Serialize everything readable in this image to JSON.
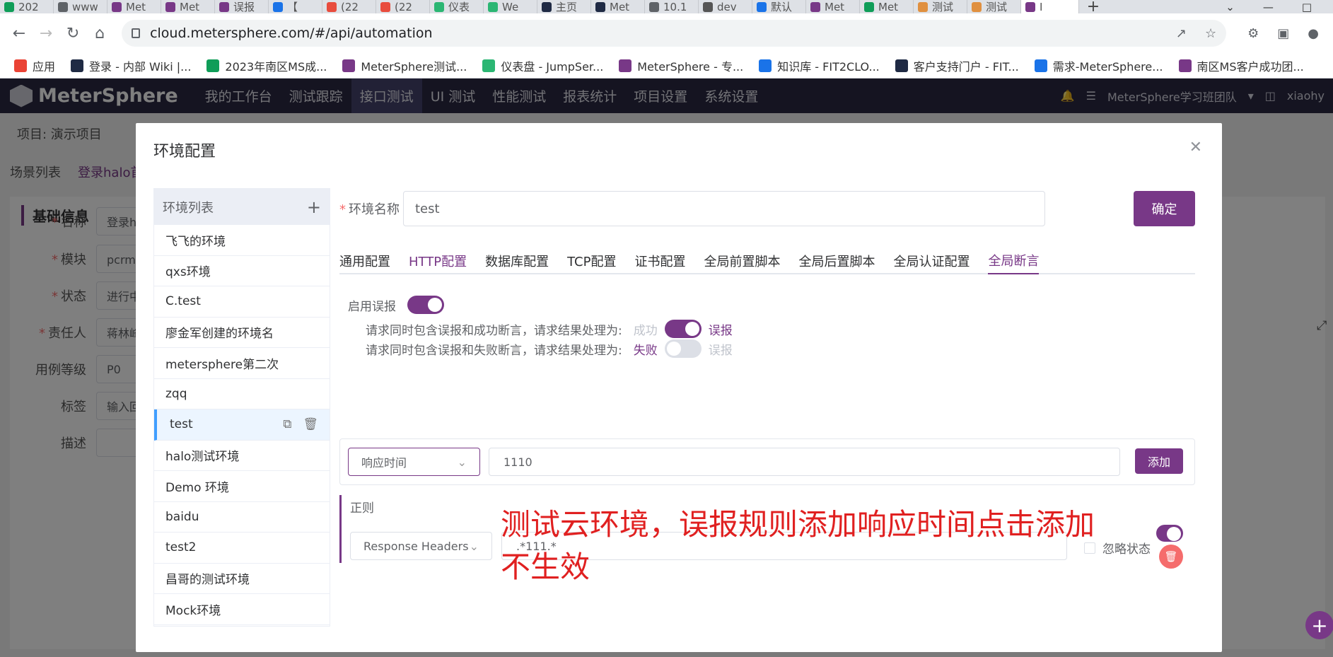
{
  "browser": {
    "tabs": [
      {
        "label": "202",
        "color": "#0f9d58"
      },
      {
        "label": "www",
        "color": "#5f6368"
      },
      {
        "label": "Met",
        "color": "#783887"
      },
      {
        "label": "Met",
        "color": "#783887"
      },
      {
        "label": "误报",
        "color": "#783887"
      },
      {
        "label": "【",
        "color": "#1a73e8"
      },
      {
        "label": "(22",
        "color": "#e84c3d"
      },
      {
        "label": "(22",
        "color": "#e84c3d"
      },
      {
        "label": "仪表",
        "color": "#2bb673"
      },
      {
        "label": "We",
        "color": "#2bb673"
      },
      {
        "label": "主页",
        "color": "#1f2a44"
      },
      {
        "label": "Met",
        "color": "#1f2a44"
      },
      {
        "label": "10.1",
        "color": "#5f6368"
      },
      {
        "label": "dev",
        "color": "#555555"
      },
      {
        "label": "默认",
        "color": "#1a73e8"
      },
      {
        "label": "Met",
        "color": "#783887"
      },
      {
        "label": "Met",
        "color": "#0f9d58"
      },
      {
        "label": "测试",
        "color": "#e09040"
      },
      {
        "label": "测试",
        "color": "#e09040"
      },
      {
        "label": "I",
        "color": "#783887"
      }
    ],
    "new_tab": "+",
    "url": "cloud.metersphere.com/#/api/automation",
    "bookmarks": [
      {
        "label": "应用",
        "color": "#ea4335"
      },
      {
        "label": "登录 - 内部 Wiki |...",
        "color": "#1f2a44"
      },
      {
        "label": "2023年南区MS成...",
        "color": "#0f9d58"
      },
      {
        "label": "MeterSphere测试...",
        "color": "#783887"
      },
      {
        "label": "仪表盘 - JumpSer...",
        "color": "#2bb673"
      },
      {
        "label": "MeterSphere - 专...",
        "color": "#783887"
      },
      {
        "label": "知识库 - FIT2CLO...",
        "color": "#1a73e8"
      },
      {
        "label": "客户支持门户 - FIT...",
        "color": "#1f2a44"
      },
      {
        "label": "需求-MeterSphere...",
        "color": "#1a73e8"
      },
      {
        "label": "南区MS客户成功团...",
        "color": "#783887"
      }
    ]
  },
  "app": {
    "logo": "MeterSphere",
    "menu": [
      "我的工作台",
      "测试跟踪",
      "接口测试",
      "UI 测试",
      "性能测试",
      "报表统计",
      "项目设置",
      "系统设置"
    ],
    "active_menu": 2,
    "team": "MeterSphere学习班团队",
    "user": "xiaohy"
  },
  "background": {
    "project": "项目: 演示项目",
    "tabs": [
      "场景列表",
      "登录halo首"
    ],
    "section": "基础信息",
    "fields": [
      {
        "label": "名称",
        "required": true,
        "value": "登录ha"
      },
      {
        "label": "模块",
        "required": true,
        "value": "pcrm个"
      },
      {
        "label": "状态",
        "required": true,
        "value": "进行中"
      },
      {
        "label": "责任人",
        "required": true,
        "value": "蒋林峰"
      },
      {
        "label": "用例等级",
        "required": false,
        "value": "P0"
      },
      {
        "label": "标签",
        "required": false,
        "value": "输入回车"
      },
      {
        "label": "描述",
        "required": false,
        "value": ""
      }
    ]
  },
  "dialog": {
    "title": "环境配置",
    "env_list_title": "环境列表",
    "environments": [
      "飞飞的环境",
      "qxs环境",
      "C.test",
      "廖金军创建的环境名",
      "metersphere第二次",
      "zqq",
      "test",
      "halo测试环境",
      "Demo 环境",
      "baidu",
      "test2",
      "昌哥的测试环境",
      "Mock环境"
    ],
    "active_env": 6,
    "name_label": "环境名称",
    "name_value": "test",
    "confirm": "确定",
    "tabs": [
      "通用配置",
      "HTTP配置",
      "数据库配置",
      "TCP配置",
      "证书配置",
      "全局前置脚本",
      "全局后置脚本",
      "全局认证配置",
      "全局断言"
    ],
    "false_alarm": {
      "enable_label": "启用误报",
      "rule1_text": "请求同时包含误报和成功断言，请求结果处理为:",
      "rule1_left": "成功",
      "rule1_right": "误报",
      "rule2_text": "请求同时包含误报和失败断言，请求结果处理为:",
      "rule2_left": "失败",
      "rule2_right": "误报"
    },
    "assertion": {
      "type": "响应时间",
      "value": "1110",
      "add": "添加"
    },
    "regex": {
      "title": "正则",
      "subject": "Response Headers",
      "expression": ".*111.*",
      "ignore_status": "忽略状态"
    }
  },
  "annotation": "测试云环境，误报规则添加响应时间点击添加不生效"
}
